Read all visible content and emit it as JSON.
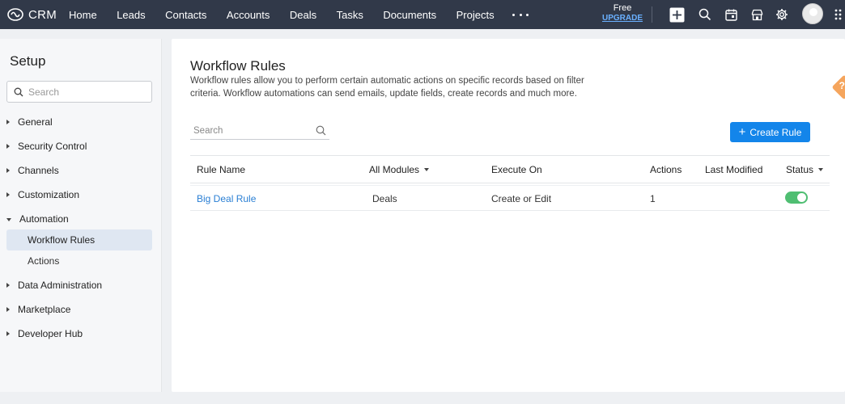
{
  "app": {
    "name": "CRM"
  },
  "nav": {
    "items": [
      "Home",
      "Leads",
      "Contacts",
      "Accounts",
      "Deals",
      "Tasks",
      "Documents",
      "Projects"
    ]
  },
  "plan": {
    "label": "Free",
    "upgrade": "UPGRADE"
  },
  "topbar_icons": [
    "add-icon",
    "search-icon",
    "calendar-icon",
    "marketplace-icon",
    "gear-icon",
    "grid-icon"
  ],
  "sidebar": {
    "title": "Setup",
    "search_placeholder": "Search",
    "items": [
      {
        "label": "General",
        "expanded": false
      },
      {
        "label": "Security Control",
        "expanded": false
      },
      {
        "label": "Channels",
        "expanded": false
      },
      {
        "label": "Customization",
        "expanded": false
      },
      {
        "label": "Automation",
        "expanded": true,
        "children": [
          {
            "label": "Workflow Rules",
            "active": true
          },
          {
            "label": "Actions",
            "active": false
          }
        ]
      },
      {
        "label": "Data Administration",
        "expanded": false
      },
      {
        "label": "Marketplace",
        "expanded": false
      },
      {
        "label": "Developer Hub",
        "expanded": false
      }
    ]
  },
  "main": {
    "title": "Workflow Rules",
    "description": "Workflow rules allow you to perform certain automatic actions on specific records based on filter criteria. Workflow automations can send emails, update fields, create records and much more.",
    "search_placeholder": "Search",
    "create_button": "Create Rule",
    "table": {
      "columns": [
        "Rule Name",
        "All Modules",
        "Execute On",
        "Actions",
        "Last Modified",
        "Status"
      ],
      "rows": [
        {
          "rule_name": "Big Deal Rule",
          "module": "Deals",
          "execute_on": "Create or Edit",
          "actions": "1",
          "last_modified": "",
          "status": "on"
        }
      ]
    }
  },
  "colors": {
    "topbar": "#313949",
    "accent": "#1385ea",
    "link": "#2a7fd4",
    "toggle_on": "#4fbe72"
  }
}
